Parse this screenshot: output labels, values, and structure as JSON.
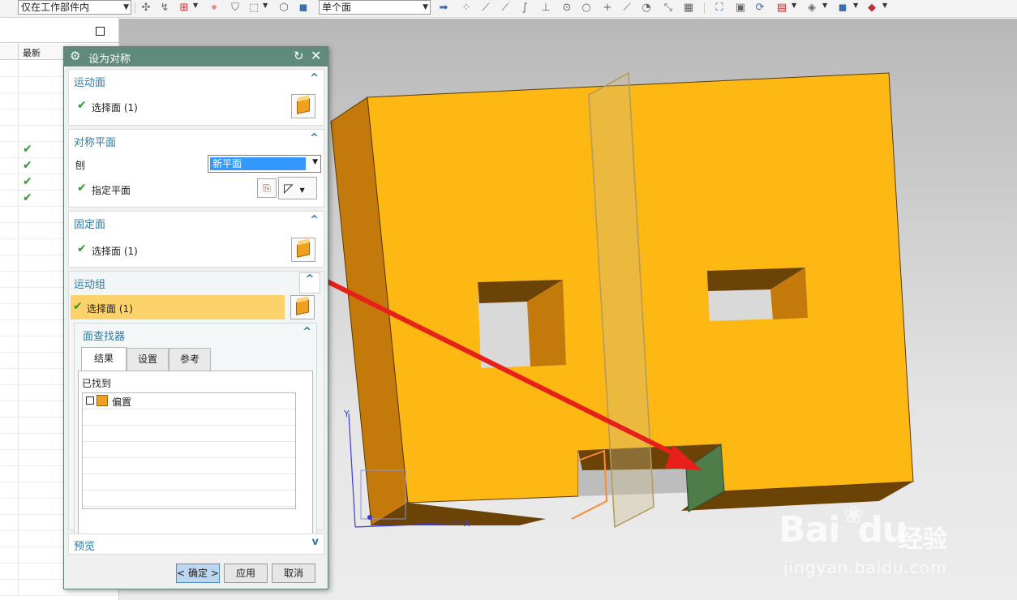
{
  "toolbar": {
    "filter_combo": "仅在工作部件内",
    "face_rule_combo": "单个面"
  },
  "nav": {
    "col_latest": "最新",
    "check_glyph": "✔"
  },
  "dialog": {
    "title": "设为对称",
    "sections": {
      "motion_face": {
        "title": "运动面",
        "select_label": "选择面 (1)"
      },
      "sym_plane": {
        "title": "对称平面",
        "plane_label": "刨",
        "plane_value": "新平面",
        "specify_label": "指定平面"
      },
      "fixed_face": {
        "title": "固定面",
        "select_label": "选择面 (1)"
      },
      "motion_group": {
        "title": "运动组",
        "select_label": "选择面 (1)"
      },
      "face_finder": {
        "title": "面查找器",
        "tabs": [
          "结果",
          "设置",
          "参考"
        ],
        "found_label": "已找到",
        "items": [
          "偏置"
        ]
      },
      "preview": {
        "title": "预览"
      }
    },
    "buttons": {
      "ok": "< 确定 >",
      "apply": "应用",
      "cancel": "取消"
    }
  },
  "scene": {
    "axis_y": "Y",
    "axis_x": "X"
  },
  "watermark": {
    "logo": "Bai",
    "logo2": "du",
    "cn": "经验",
    "url": "jingyan.baidu.com"
  },
  "colors": {
    "part_face": "#fdb813",
    "part_side": "#c47a0b",
    "part_bottom": "#6b4306",
    "selected_face": "#4e7d49",
    "arrow": "#e8201c",
    "dialog_title": "#5f8a7c",
    "section_title": "#2b7aa8"
  }
}
